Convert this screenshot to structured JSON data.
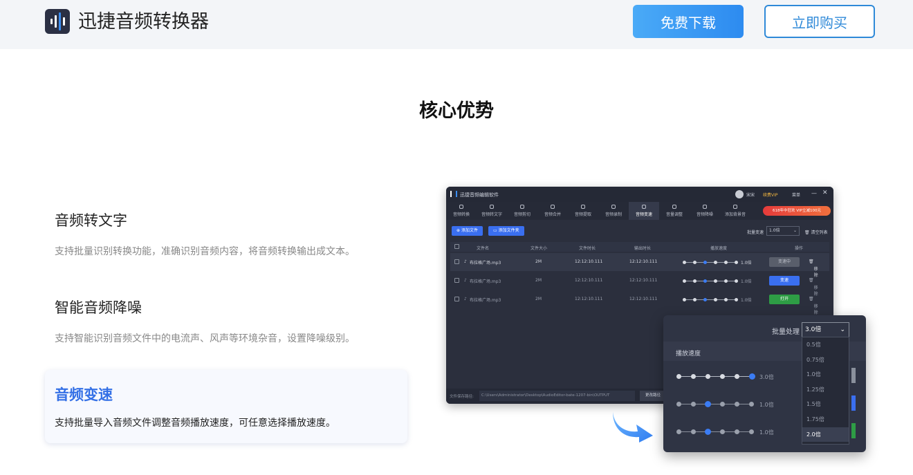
{
  "header": {
    "brand": "迅捷音频转换器",
    "download_label": "免费下载",
    "buy_label": "立即购买",
    "logo_icon": "audio-wave-icon"
  },
  "section_title": "核心优势",
  "features": [
    {
      "title": "音频转文字",
      "desc": "支持批量识别转换功能，准确识别音频内容，将音频转换输出成文本。"
    },
    {
      "title": "智能音频降噪",
      "desc": "支持智能识别音频文件中的电流声、风声等环境杂音，设置降噪级别。"
    },
    {
      "title": "音频变速",
      "desc": "支持批量导入音频文件调整音频播放速度，可任意选择播放速度。",
      "active": true
    }
  ],
  "app": {
    "title": "迅捷音频编辑软件",
    "user": "宋宋",
    "vip": "续费VIP",
    "menu": "菜单",
    "promo": "618年中狂欢 VIP立减100元",
    "tools": [
      "音频转换",
      "音频转文字",
      "音频剪切",
      "音频合并",
      "音频提取",
      "音频录制",
      "音频变速",
      "音量调整",
      "音频降噪",
      "添加背景音"
    ],
    "add_file": "添加文件",
    "add_folder": "添加文件夹",
    "batch_label": "批量变速",
    "batch_value": "1.0倍",
    "clear_list": "清空列表",
    "columns": [
      "文件名",
      "文件大小",
      "文件时长",
      "输出时长",
      "播放速度",
      "操作"
    ],
    "rows": [
      {
        "name": "布拉格广场.mp3",
        "size": "2M",
        "dur": "12:12:10.111",
        "out": "12:12:10.111",
        "speed": "1.0倍",
        "op": "变速中"
      },
      {
        "name": "布拉格广场.mp3",
        "size": "2M",
        "dur": "12:12:10.111",
        "out": "12:12:10.111",
        "speed": "1.0倍",
        "op": "变速",
        "remove": "移除"
      },
      {
        "name": "布拉格广场.mp3",
        "size": "2M",
        "dur": "12:12:10.111",
        "out": "12:12:10.111",
        "speed": "1.0倍",
        "op": "打开",
        "remove": "移除"
      }
    ],
    "remove": "移除",
    "save_path_label": "文件保存路径:",
    "save_path": "C:\\Users\\Administrator\\Desktop\\AudioEditor-bate-1207-bin\\OUTPUT",
    "change_path": "更改路径"
  },
  "popup": {
    "batch_label": "批量处理",
    "batch_value": "3.0倍",
    "speed_header": "播放速度",
    "row_speeds": [
      "3.0倍",
      "1.0倍",
      "1.0倍"
    ],
    "options": [
      "0.5倍",
      "0.75倍",
      "1.0倍",
      "1.25倍",
      "1.5倍",
      "1.75倍",
      "2.0倍"
    ],
    "selected": "2.0倍"
  },
  "colors": {
    "accent": "#3470e6",
    "download_bg": "#2d8bf0",
    "buy_border": "#2e89d8",
    "green": "#2e9d45",
    "blue_btn": "#3a6ff0"
  }
}
